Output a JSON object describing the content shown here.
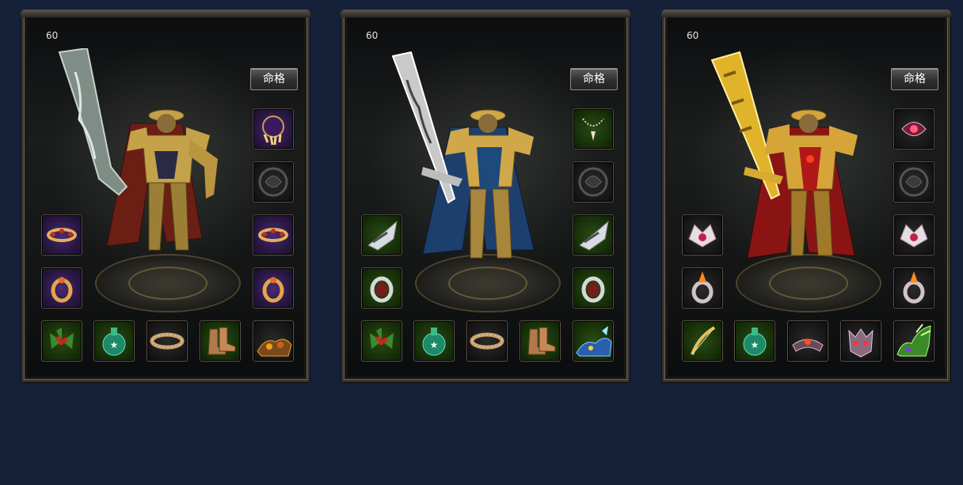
{
  "panels": [
    {
      "level": "60",
      "fate_button": "命格",
      "theme": "bronze",
      "weapon_color": "#7f8d86",
      "armor_color": "#c4a24a",
      "cape_color": "#6a1e14"
    },
    {
      "level": "60",
      "fate_button": "命格",
      "theme": "silver-blue",
      "weapon_color": "#c9c9c9",
      "armor_color": "#d0a84a",
      "cape_color": "#1d3f6e"
    },
    {
      "level": "60",
      "fate_button": "命格",
      "theme": "gold-red",
      "weapon_color": "#e1b32a",
      "armor_color": "#d6a53a",
      "cape_color": "#8a1414"
    }
  ],
  "slot_icons": {
    "panel1": [
      "necklace-claw-icon",
      "helmet-dragon-icon",
      "bracelet-left-icon",
      "bracelet-right-icon",
      "ring-left-icon",
      "ring-right-icon",
      "holly-charm-icon",
      "potion-icon",
      "belt-icon",
      "boots-icon",
      "mount-beast-icon"
    ],
    "panel2": [
      "necklace-chain-icon",
      "helmet-dragon-icon",
      "bracer-left-icon",
      "bracer-right-icon",
      "ring-left-icon",
      "ring-right-icon",
      "holly-charm-icon",
      "potion-icon",
      "belt-icon",
      "boots-icon",
      "mount-beast-icon"
    ],
    "panel3": [
      "necklace-gem-icon",
      "helmet-dragon-icon",
      "bracelet-left-icon",
      "bracelet-right-icon",
      "ring-left-icon",
      "ring-right-icon",
      "bow-charm-icon",
      "potion-icon",
      "crown-belt-icon",
      "demon-mask-icon",
      "mount-beast-icon"
    ]
  }
}
